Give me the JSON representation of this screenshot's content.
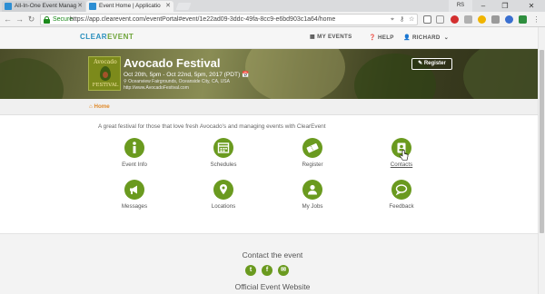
{
  "browser": {
    "tabs": [
      {
        "title": "All-In-One Event Manag"
      },
      {
        "title": "Event Home | Applicatio"
      }
    ],
    "user_badge": "RS",
    "controls": {
      "minimize": "–",
      "maximize": "❐",
      "close": "✕"
    },
    "address": {
      "secure_label": "Secure",
      "url": "https://app.clearevent.com/eventPortal#event/1e22ad09-3ddc-49fa-8cc9-e6bd903c1a64/home"
    }
  },
  "site": {
    "logo_part1": "CLEAR",
    "logo_part2": "EVENT",
    "nav": {
      "my_events": "MY EVENTS",
      "help": "HELP",
      "user": "RICHARD"
    }
  },
  "event": {
    "logo_top": "Avocado",
    "logo_bottom": "FESTIVAL",
    "title": "Avocado Festival",
    "dates": "Oct 20th, 5pm - Oct 22nd, 5pm, 2017 (PDT)",
    "location": "Oceanview Fairgrounds, Oceanside City, CA, USA",
    "website": "http://www.AvocadoFestival.com",
    "register_label": "Register"
  },
  "breadcrumb": {
    "home": "Home"
  },
  "tagline": "A great festival for those that love fresh Avocado's and managing events with ClearEvent",
  "tiles": [
    {
      "label": "Event Info",
      "icon": "info-icon"
    },
    {
      "label": "Schedules",
      "icon": "calendar-icon"
    },
    {
      "label": "Register",
      "icon": "ticket-icon"
    },
    {
      "label": "Contacts",
      "icon": "contact-card-icon"
    },
    {
      "label": "Messages",
      "icon": "megaphone-icon"
    },
    {
      "label": "Locations",
      "icon": "map-pin-icon"
    },
    {
      "label": "My Jobs",
      "icon": "person-icon"
    },
    {
      "label": "Feedback",
      "icon": "speech-bubble-icon"
    }
  ],
  "footer": {
    "contact_title": "Contact the event",
    "official_title": "Official Event Website"
  },
  "colors": {
    "accent_green": "#6a9a1f",
    "brand_blue": "#2a8fbd",
    "breadcrumb_orange": "#e08a2a"
  }
}
